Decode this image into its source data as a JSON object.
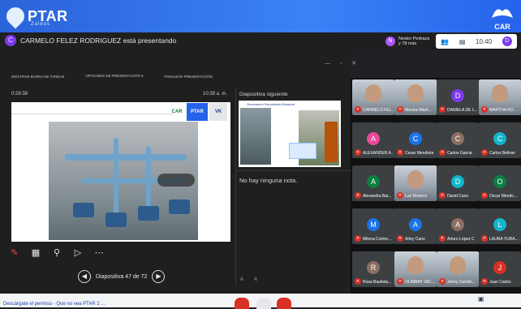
{
  "brand": {
    "name": "PTAR",
    "sub": "Zaleos",
    "right_logo": "CAR"
  },
  "presenter": {
    "avatar": "C",
    "text": "CARMELO FELEZ RODRIGUEZ está presentando"
  },
  "viewer": {
    "avatar": "N",
    "text": "Nestor Pedraza y 78 más"
  },
  "meeting": {
    "participants_icon": "people-icon",
    "chat_icon": "chat-icon",
    "time": "10:40",
    "account_avatar": "D"
  },
  "toolbar": {
    "items": [
      "MOSTRAR BARRA DE TAREAS",
      "OPCIONES DE PRESENTACIÓN ▾",
      "FINALIZAR PRESENTACIÓN"
    ]
  },
  "presentation": {
    "timer": "0:29:38",
    "clock": "10:39 a. m.",
    "slide_logos": [
      "CAR",
      "PTAR",
      "VK"
    ],
    "slide_counter": "Diapositiva 47 de 72",
    "next_label": "Diapositiva siguiente",
    "next_title": "Generación Secundaria Biosorret",
    "notes": "No hay ninguna nota.",
    "font_ctrls": "A A"
  },
  "participants": [
    {
      "name": "CARMELO FEL...",
      "avatar": "",
      "color": "#3c4043",
      "video": true
    },
    {
      "name": "Monica Marit...",
      "avatar": "",
      "color": "#3c4043",
      "video": true
    },
    {
      "name": "DANIELA DE L...",
      "avatar": "D",
      "color": "#7c3aed",
      "video": false
    },
    {
      "name": "MARTHA RO...",
      "avatar": "",
      "color": "#3c4043",
      "video": true
    },
    {
      "name": "ALEXANDER A...",
      "avatar": "A",
      "color": "#ec4899",
      "video": false
    },
    {
      "name": "Cesar Mendieta",
      "avatar": "C",
      "color": "#1a73e8",
      "video": false
    },
    {
      "name": "Carlos Garcia",
      "avatar": "C",
      "color": "#8d6e63",
      "video": false
    },
    {
      "name": "Carlos Beltran",
      "avatar": "C",
      "color": "#12b5cb",
      "video": false
    },
    {
      "name": "Alexandra Bar...",
      "avatar": "A",
      "color": "#0b8043",
      "video": false
    },
    {
      "name": "Luz Romero",
      "avatar": "",
      "color": "#3c4043",
      "video": true
    },
    {
      "name": "David Cano",
      "avatar": "D",
      "color": "#12b5cb",
      "video": false
    },
    {
      "name": "Oscar Mendo...",
      "avatar": "O",
      "color": "#0b8043",
      "video": false
    },
    {
      "name": "Milena Contre...",
      "avatar": "M",
      "color": "#1a73e8",
      "video": false
    },
    {
      "name": "Arley Cano",
      "avatar": "A",
      "color": "#1a73e8",
      "video": false
    },
    {
      "name": "Arturo Lopez C",
      "avatar": "A",
      "color": "#8d6e63",
      "video": false
    },
    {
      "name": "LAURA YURA...",
      "avatar": "L",
      "color": "#12b5cb",
      "video": false
    },
    {
      "name": "Rosa Bautista...",
      "avatar": "R",
      "color": "#8d6e63",
      "video": false
    },
    {
      "name": "OLIMBAY JAC...",
      "avatar": "",
      "color": "#3c4043",
      "video": true
    },
    {
      "name": "Jenny Carolin...",
      "avatar": "",
      "color": "#3c4043",
      "video": true
    },
    {
      "name": "Juan Carlos",
      "avatar": "J",
      "color": "#d93025",
      "video": false
    }
  ],
  "bottom": {
    "text": "Descárgate el permiso - Que no vea PTAR 2 ..."
  }
}
